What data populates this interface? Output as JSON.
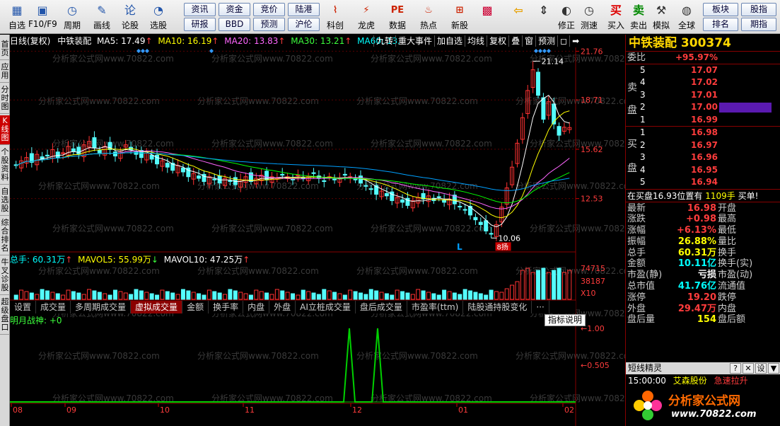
{
  "toolbar": {
    "items": [
      {
        "label": "自选",
        "icon": "grid-icon"
      },
      {
        "label": "F10/F9",
        "icon": "monitor-icon"
      },
      {
        "label": "周期",
        "icon": "clock-icon"
      },
      {
        "label": "画线",
        "icon": "pencil-icon"
      },
      {
        "label": "论股",
        "icon": "lun-icon"
      },
      {
        "label": "选股",
        "icon": "chart-icon"
      }
    ],
    "small_buttons": [
      "资讯",
      "资金",
      "竞价",
      "陆港",
      "研报",
      "BBD",
      "预测",
      "沪伦"
    ],
    "items2": [
      {
        "label": "科创",
        "icon": "kechuang-icon"
      },
      {
        "label": "龙虎",
        "icon": "tiger-icon"
      },
      {
        "label": "数据",
        "icon": "pe-icon"
      },
      {
        "label": "热点",
        "icon": "hot-icon"
      },
      {
        "label": "新股",
        "icon": "ipo-icon"
      }
    ],
    "items3": [
      {
        "label": "",
        "icon": "palette-icon"
      },
      {
        "label": "",
        "icon": "back-arrow-icon"
      },
      {
        "label": "",
        "icon": "up-down-icon"
      },
      {
        "label": "修正",
        "icon": "fix-icon"
      },
      {
        "label": "测速",
        "icon": "speed-icon"
      },
      {
        "label": "买入",
        "icon": "buy-icon"
      },
      {
        "label": "卖出",
        "icon": "sell-icon"
      },
      {
        "label": "模拟",
        "icon": "hammer-icon"
      },
      {
        "label": "全球",
        "icon": "globe-icon"
      }
    ],
    "right_buttons": [
      "板块",
      "股指",
      "排名",
      "期指"
    ],
    "buy_glyph": "买",
    "sell_glyph": "卖"
  },
  "sidebar": [
    "首页",
    "应用",
    "分时图",
    "K线图",
    "个股资料",
    "自选股",
    "综合排名",
    "牛叉诊股",
    "超级盘口"
  ],
  "chart": {
    "legend": {
      "period": "日线(复权)",
      "name": "中铁装配",
      "ma5": "MA5: 17.49",
      "ma10": "MA10: 16.19",
      "ma20": "MA20: 13.83",
      "ma30": "MA30: 13.21",
      "ma60": "MA60: 13."
    },
    "tabs": [
      "九转",
      "重大事件",
      "加自选",
      "均线",
      "复权",
      "叠",
      "窗",
      "预测",
      "◻",
      "➡"
    ],
    "y_labels": [
      "21.76",
      "18.71",
      "15.62",
      "12.53"
    ],
    "high_label": "21.14",
    "low_label": "10.06",
    "low_marker": "8扬",
    "l_marker": "L",
    "vol_legend": {
      "total": "总手: 60.31万",
      "mavol5": "MAVOL5: 55.99万",
      "mavol10": "MAVOL10: 47.25万"
    },
    "vol_y_labels": [
      "74715",
      "38187",
      "X10"
    ],
    "panel_tabs": [
      "设置",
      "成交量",
      "多周期成交量",
      "虚拟成交量",
      "金额",
      "换手率",
      "内盘",
      "外盘",
      "AI立桩成交量",
      "盘后成交量",
      "市盈率(ttm)",
      "陆股通持股变化",
      "···"
    ],
    "active_panel_tab": 3,
    "indicator": {
      "name": "明月战神: +0",
      "help": "指标说明",
      "y_labels": [
        "1.00",
        "0.505"
      ]
    },
    "x_labels": [
      "08",
      "09",
      "10",
      "11",
      "12",
      "01",
      "02"
    ],
    "watermark": "分析家公式网www.70822.com"
  },
  "chart_data": {
    "type": "candlestick",
    "title": "中铁装配 300374 日线(复权)",
    "ylim": [
      9.5,
      22
    ],
    "price_ticks": [
      21.76,
      18.71,
      15.62,
      12.53
    ],
    "high": 21.14,
    "low": 10.06,
    "x_ticks": [
      "08",
      "09",
      "10",
      "11",
      "12",
      "01",
      "02"
    ],
    "closes": [
      14.6,
      14.9,
      15.1,
      14.8,
      15.3,
      15.0,
      15.2,
      15.6,
      15.1,
      15.4,
      15.8,
      15.5,
      15.3,
      15.9,
      16.1,
      15.7,
      15.4,
      15.8,
      15.6,
      15.2,
      15.5,
      15.9,
      15.6,
      15.3,
      15.1,
      15.4,
      15.0,
      14.7,
      14.9,
      14.5,
      14.3,
      14.6,
      14.2,
      13.9,
      14.1,
      13.8,
      13.6,
      13.9,
      13.7,
      13.5,
      13.8,
      13.6,
      13.4,
      13.7,
      13.9,
      13.6,
      13.8,
      14.0,
      13.7,
      13.9,
      13.8,
      14.0,
      13.9,
      13.7,
      14.0,
      13.8,
      13.9,
      14.1,
      13.8,
      13.6,
      13.9,
      13.7,
      13.8,
      14.0,
      13.9,
      13.7,
      13.5,
      13.3,
      13.1,
      12.8,
      13.0,
      12.7,
      12.4,
      12.6,
      12.3,
      12.1,
      12.4,
      12.6,
      12.5,
      12.7,
      12.4,
      12.6,
      12.3,
      12.5,
      12.2,
      12.0,
      11.8,
      11.5,
      11.2,
      10.9,
      10.5,
      10.3,
      10.9,
      12.0,
      13.2,
      14.5,
      16.0,
      17.6,
      19.3,
      20.6,
      19.0,
      17.5,
      18.6,
      17.2,
      16.5,
      17.0,
      16.98
    ],
    "ma": {
      "MA5": 17.49,
      "MA10": 16.19,
      "MA20": 13.83,
      "MA30": 13.21
    },
    "volume_ticks": [
      74715,
      38187
    ],
    "volume_unit": "X10",
    "total_volume": "60.31万",
    "mavol5": "55.99万",
    "mavol10": "47.25万",
    "indicator_name": "明月战神",
    "indicator_ticks": [
      1.0,
      0.505
    ],
    "indicator_spikes_x_frac": [
      0.6,
      0.65
    ]
  },
  "quote": {
    "title": "中铁装配 300374",
    "weibi_label": "委比",
    "weibi_value": "+95.97%",
    "sell_label": [
      "卖",
      "盘"
    ],
    "buy_label": [
      "买",
      "盘"
    ],
    "asks": [
      {
        "idx": "5",
        "price": "17.07"
      },
      {
        "idx": "4",
        "price": "17.02"
      },
      {
        "idx": "3",
        "price": "17.01"
      },
      {
        "idx": "2",
        "price": "17.00"
      },
      {
        "idx": "1",
        "price": "16.99"
      }
    ],
    "bids": [
      {
        "idx": "1",
        "price": "16.98"
      },
      {
        "idx": "2",
        "price": "16.97"
      },
      {
        "idx": "3",
        "price": "16.96"
      },
      {
        "idx": "4",
        "price": "16.95"
      },
      {
        "idx": "5",
        "price": "16.94"
      }
    ],
    "notice_prefix": "在买盘16.93位置有",
    "notice_qty": "1109手",
    "notice_suffix": "买单!",
    "stats": [
      {
        "k": "最新",
        "v": "16.98",
        "k2": "开盘",
        "color": "red"
      },
      {
        "k": "涨跌",
        "v": "+0.98",
        "k2": "最高",
        "color": "red"
      },
      {
        "k": "涨幅",
        "v": "+6.13%",
        "k2": "最低",
        "color": "red"
      },
      {
        "k": "振幅",
        "v": "26.88%",
        "k2": "量比",
        "color": "yellow"
      },
      {
        "k": "总手",
        "v": "60.31万",
        "k2": "换手",
        "color": "yellow"
      },
      {
        "k": "金额",
        "v": "10.11亿",
        "k2": "换手(实)",
        "color": "cyan"
      },
      {
        "k": "市盈(静)",
        "v": "亏损",
        "k2": "市盈(动)",
        "color": "white"
      },
      {
        "k": "总市值",
        "v": "41.76亿",
        "k2": "流通值",
        "color": "cyan"
      },
      {
        "k": "涨停",
        "v": "19.20",
        "k2": "跌停",
        "color": "red"
      },
      {
        "k": "外盘",
        "v": "29.47万",
        "k2": "内盘",
        "color": "red"
      },
      {
        "k": "盘后量",
        "v": "154",
        "k2": "盘后额",
        "color": "yellow"
      }
    ],
    "elves_label": "短线精灵",
    "elves_buttons": [
      "?",
      "✕",
      "设",
      "▼"
    ],
    "elves_time": "15:00:00",
    "elves_stock": "艾森股份",
    "elves_event": "急速拉升",
    "logo_text": "分析家公式网",
    "logo_url": "www.70822.com"
  }
}
